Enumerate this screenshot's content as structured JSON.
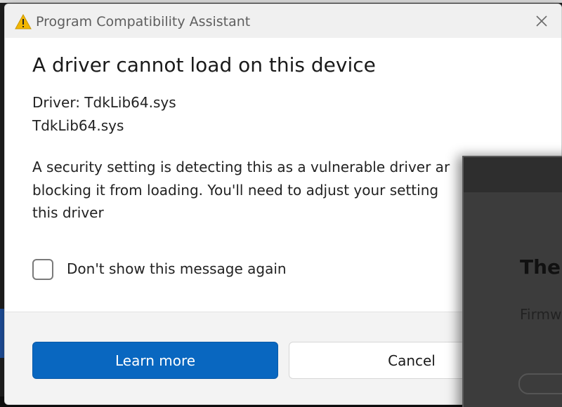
{
  "dialog": {
    "title": "Program Compatibility Assistant",
    "heading": "A driver cannot load on this device",
    "driver_line": "Driver: TdkLib64.sys",
    "driver_file": "TdkLib64.sys",
    "message_lines": [
      "A security setting is detecting this as a vulnerable driver ar",
      "blocking it from loading. You'll need to adjust your setting",
      "this driver"
    ],
    "checkbox_label": "Don't show this message again",
    "checkbox_checked": false,
    "primary_button": "Learn more",
    "secondary_button": "Cancel"
  },
  "background_window": {
    "heading": "The",
    "subtext": "Firmw"
  },
  "colors": {
    "primary_button": "#0967c0",
    "warning_icon": "#f2b600",
    "background_window": "#3c3c3c"
  },
  "icons": {
    "title": "warning-icon",
    "close": "close-icon"
  }
}
